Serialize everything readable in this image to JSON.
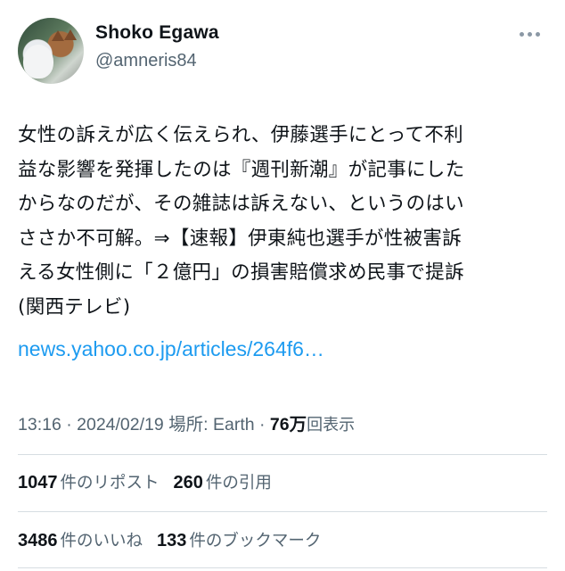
{
  "author": {
    "name": "Shoko Egawa",
    "handle": "@amneris84"
  },
  "tweet": {
    "text": "女性の訴えが広く伝えられ、伊藤選手にとって不利\n益な影響を発揮したのは『週刊新潮』が記事にした\nからなのだが、その雑誌は訴えない、というのはい\nささか不可解。⇒【速報】伊東純也選手が性被害訴\nえる女性側に「２億円」の損害賠償求め民事で提訴\n(関西テレビ)",
    "link_text": "news.yahoo.co.jp/articles/264f6…"
  },
  "meta": {
    "time_date_location": "13:16 · 2024/02/19 場所: Earth · ",
    "views_count": "76万",
    "views_label": "回表示"
  },
  "stats": {
    "reposts_count": "1047",
    "reposts_label": "件のリポスト",
    "quotes_count": "260",
    "quotes_label": "件の引用",
    "likes_count": "3486",
    "likes_label": "件のいいね",
    "bookmarks_count": "133",
    "bookmarks_label": "件のブックマーク"
  },
  "icons": {
    "more": "more-horizontal-icon",
    "avatar": "profile-avatar"
  },
  "colors": {
    "link": "#1d9bf0",
    "secondary_text": "#536471",
    "primary_text": "#0f1419",
    "divider": "#d6dde2"
  }
}
